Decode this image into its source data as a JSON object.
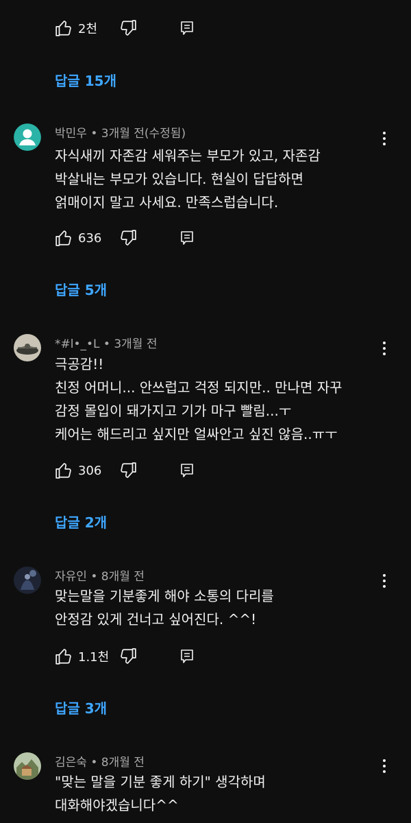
{
  "top_actions": {
    "likes": "2천"
  },
  "comments": [
    {
      "replies": "답글 15개",
      "author_meta": "박민우 • 3개월 전(수정됨)",
      "lines": [
        "자식새끼 자존감 세워주는 부모가 있고,   자존감",
        "박살내는 부모가 있습니다.  현실이 답답하면",
        "얽매이지 말고 사세요. 만족스럽습니다."
      ],
      "likes": "636"
    },
    {
      "replies": "답글 5개",
      "author_meta": "*#l•_•L • 3개월 전",
      "lines": [
        "극공감!!",
        "친정 어머니... 안쓰럽고 걱정 되지만.. 만나면 자꾸",
        "감정 몰입이 돼가지고 기가 마구 빨림...ㅜ",
        "케어는 해드리고 싶지만 얼싸안고 싶진 않음..ㅠㅜ"
      ],
      "likes": "306"
    },
    {
      "replies": "답글 2개",
      "author_meta": "자유인 • 8개월 전",
      "lines": [
        "맞는말을 기분좋게 해야 소통의 다리를",
        "안정감 있게 건너고 싶어진다. ^^!"
      ],
      "likes": "1.1천"
    },
    {
      "replies": "답글 3개",
      "author_meta": "김은숙 • 8개월 전",
      "lines": [
        "\"맞는 말을 기분 좋게 하기\" 생각하며",
        "대화해야겠습니다^^"
      ],
      "likes": ""
    }
  ],
  "colors": {
    "background": "#0f0f0f",
    "text": "#f1f1f1",
    "meta": "#aaaaaa",
    "link": "#3ea6ff"
  },
  "icons": [
    "thumb-up-icon",
    "thumb-down-icon",
    "reply-icon",
    "more-vert-icon",
    "default-avatar-icon"
  ]
}
